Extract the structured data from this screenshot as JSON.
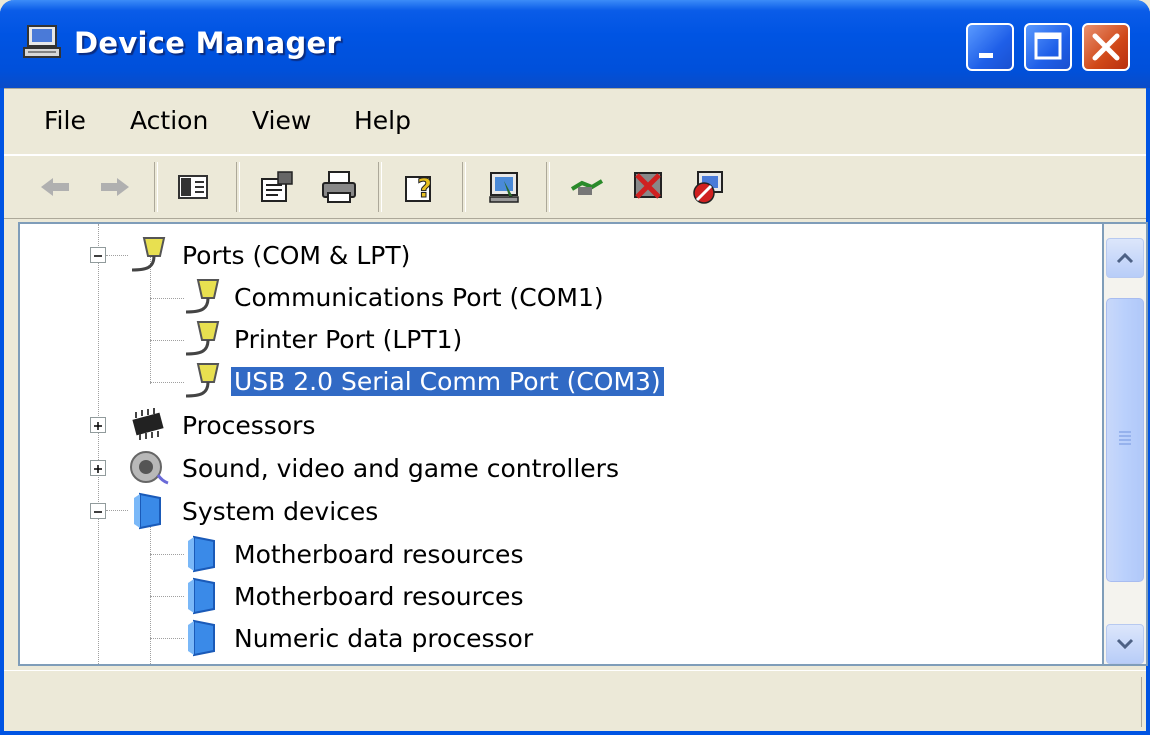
{
  "window": {
    "title": "Device Manager",
    "colors": {
      "titlebar": "#0054E3",
      "selection": "#316AC5",
      "chrome": "#ECE9D8"
    }
  },
  "menu": {
    "file": "File",
    "action": "Action",
    "view": "View",
    "help": "Help"
  },
  "toolbar": {
    "icons": [
      "back-arrow-icon",
      "forward-arrow-icon",
      "show-hide-console-tree-icon",
      "properties-icon",
      "print-icon",
      "help-icon",
      "scan-hardware-icon",
      "update-driver-icon",
      "uninstall-icon",
      "disable-icon"
    ]
  },
  "tree": {
    "ports": "Ports (COM & LPT)",
    "com1": "Communications Port (COM1)",
    "lpt1": "Printer Port (LPT1)",
    "com3": "USB 2.0 Serial Comm Port (COM3)",
    "processors": "Processors",
    "sound": "Sound, video and game controllers",
    "system": "System devices",
    "mb1": "Motherboard resources",
    "mb2": "Motherboard resources",
    "ndp": "Numeric data processor"
  }
}
